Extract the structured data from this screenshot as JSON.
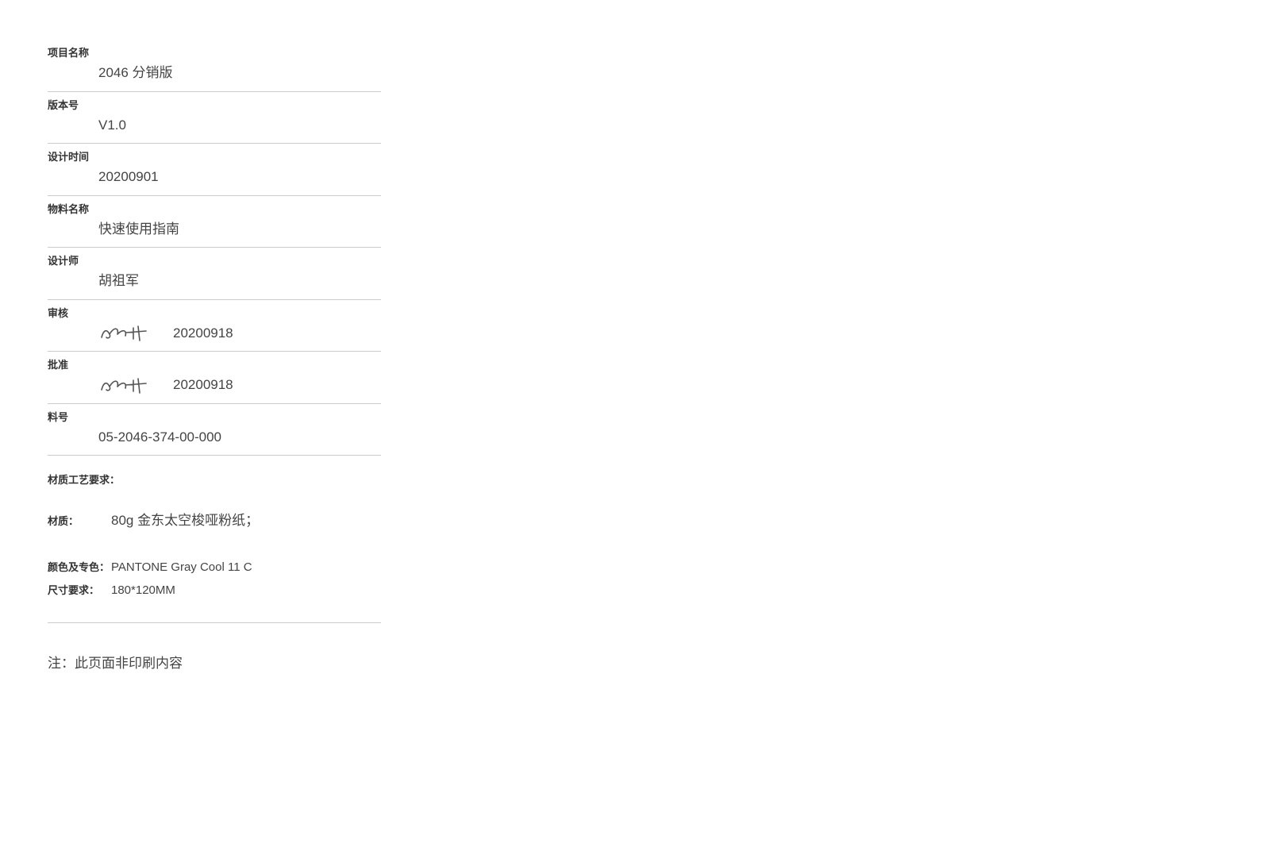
{
  "fields": {
    "project_name": {
      "label": "项目名称",
      "value": "2046 分销版"
    },
    "version": {
      "label": "版本号",
      "value": "V1.0"
    },
    "design_date": {
      "label": "设计时间",
      "value": "20200901"
    },
    "material_name": {
      "label": "物料名称",
      "value": "快速使用指南"
    },
    "designer": {
      "label": "设计师",
      "value": "胡祖军"
    },
    "review": {
      "label": "审核",
      "date": "20200918"
    },
    "approve": {
      "label": "批准",
      "date": "20200918"
    },
    "part_no": {
      "label": "料号",
      "value": "05-2046-374-00-000"
    }
  },
  "spec": {
    "title": "材质工艺要求：",
    "material": {
      "label": "材质：",
      "value": "80g 金东太空梭哑粉纸；"
    },
    "color": {
      "label": "颜色及专色：",
      "value": "PANTONE Gray Cool 11 C"
    },
    "size": {
      "label": "尺寸要求：",
      "value": "180*120MM"
    }
  },
  "note": "注：此页面非印刷内容"
}
